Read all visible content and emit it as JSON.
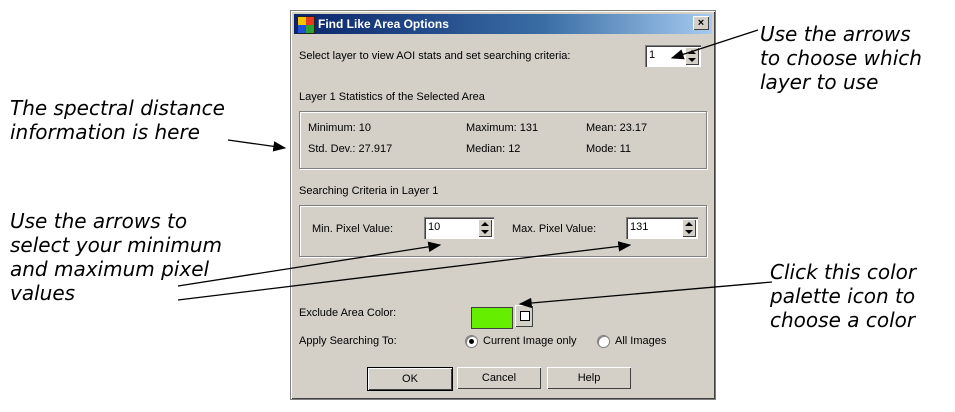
{
  "dialog": {
    "title": "Find Like Area Options",
    "close_label": "×",
    "layer_prompt": "Select layer to view AOI stats and set searching criteria:",
    "layer_value": "1",
    "stats_group_label": "Layer 1 Statistics of the Selected Area",
    "stats": {
      "minimum": "Minimum: 10",
      "maximum": "Maximum: 131",
      "mean": "Mean: 23.17",
      "std_dev": "Std. Dev.: 27.917",
      "median": "Median: 12",
      "mode": "Mode: 11"
    },
    "criteria_group_label": "Searching Criteria in Layer 1",
    "min_label": "Min. Pixel Value:",
    "min_value": "10",
    "max_label": "Max. Pixel Value:",
    "max_value": "131",
    "exclude_label": "Exclude Area Color:",
    "exclude_color": "#66ee00",
    "apply_label": "Apply Searching To:",
    "radio_current": "Current Image only",
    "radio_all": "All Images",
    "ok_label": "OK",
    "cancel_label": "Cancel",
    "help_label": "Help"
  },
  "annotations": {
    "spectral_line1": "The spectral distance",
    "spectral_line2": "information is here",
    "minmax_line1": "Use the arrows to",
    "minmax_line2": "select your minimum",
    "minmax_line3": "and maximum pixel",
    "minmax_line4": "values",
    "layer_line1": "Use the arrows",
    "layer_line2": "to choose which",
    "layer_line3": "layer to use",
    "palette_line1": "Click this color",
    "palette_line2": "palette icon to",
    "palette_line3": "choose a color"
  }
}
